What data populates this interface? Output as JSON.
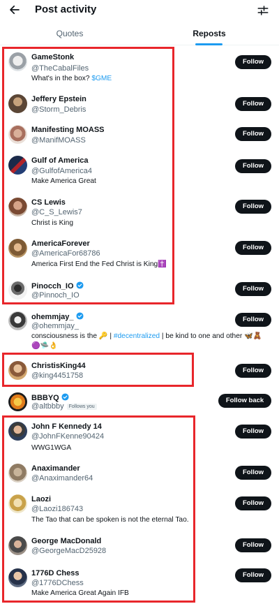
{
  "header": {
    "title": "Post activity",
    "back_icon": "arrow-left-icon",
    "settings_icon": "sliders-icon"
  },
  "tabs": [
    {
      "label": "Quotes",
      "active": false
    },
    {
      "label": "Reposts",
      "active": true
    }
  ],
  "colors": {
    "accent": "#1d9bf0",
    "highlight_box": "#e8262b",
    "button": "#0f1419"
  },
  "users": [
    {
      "name": "GameStonk",
      "handle": "@TheCabalFiles",
      "bio": "What's in the box? ",
      "bio_link": "$GME",
      "button": "Follow",
      "verified": false
    },
    {
      "name": "Jeffery Epstein",
      "handle": "@Storm_Debris",
      "bio": "",
      "button": "Follow",
      "verified": false
    },
    {
      "name": "Manifesting MOASS",
      "handle": "@ManifMOASS",
      "bio": "",
      "button": "Follow",
      "verified": false
    },
    {
      "name": "Gulf of America",
      "handle": "@GulfofAmerica4",
      "bio": "Make America Great",
      "button": "Follow",
      "verified": false
    },
    {
      "name": "CS Lewis",
      "handle": "@C_S_Lewis7",
      "bio": "Christ is King",
      "button": "Follow",
      "verified": false
    },
    {
      "name": "AmericaForever",
      "handle": "@AmericaFor68786",
      "bio": "America First End the Fed Christ is King✝️",
      "button": "Follow",
      "verified": false
    },
    {
      "name": "Pinocch_IO",
      "handle": "@Pinnoch_IO",
      "bio": "",
      "button": "Follow",
      "verified": true
    },
    {
      "name": "ohemmjay_",
      "handle": "@ohemmjay_",
      "bio": "consciousness is the 🔑 | ",
      "bio_link": "#decentralized",
      "bio_after": " | be kind to one and other 🦋🧸",
      "bio_line2": "🟣🛸👌",
      "button": "Follow",
      "verified": true
    },
    {
      "name": "ChristisKing44",
      "handle": "@king4451758",
      "bio": "",
      "button": "Follow",
      "verified": false
    },
    {
      "name": "BBBYQ",
      "handle": "@altbbby",
      "follows_you": "Follows you",
      "bio": "",
      "button": "Follow back",
      "verified": true
    },
    {
      "name": "John F Kennedy 14",
      "handle": "@JohnFKenne90424",
      "bio": "WWG1WGA",
      "button": "Follow",
      "verified": false
    },
    {
      "name": "Anaximander",
      "handle": "@Anaximander64",
      "bio": "",
      "button": "Follow",
      "verified": false
    },
    {
      "name": "Laozi",
      "handle": "@Laozi186743",
      "bio": "The Tao that can be spoken is not the eternal Tao.",
      "button": "Follow",
      "verified": false
    },
    {
      "name": "George MacDonald",
      "handle": "@GeorgeMacD25928",
      "bio": "",
      "button": "Follow",
      "verified": false
    },
    {
      "name": "1776D Chess",
      "handle": "@1776DChess",
      "bio": "Make America Great Again IFB",
      "button": "Follow",
      "verified": false
    }
  ]
}
